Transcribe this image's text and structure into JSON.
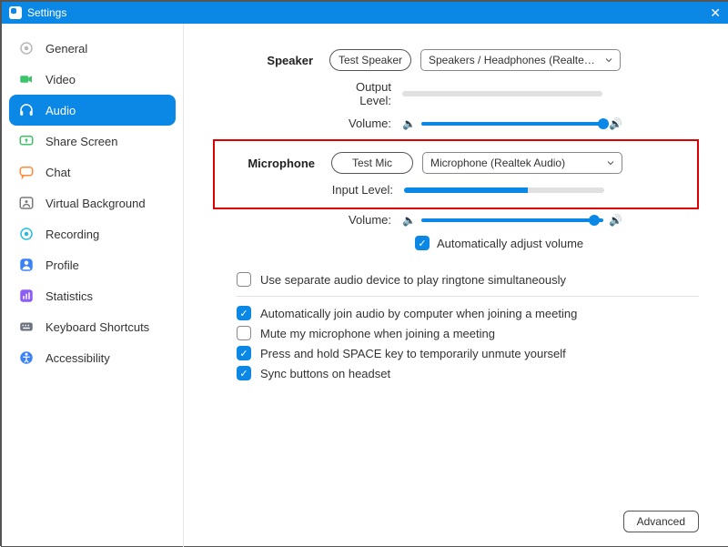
{
  "titlebar": {
    "title": "Settings"
  },
  "sidebar": {
    "items": [
      {
        "label": "General"
      },
      {
        "label": "Video"
      },
      {
        "label": "Audio"
      },
      {
        "label": "Share Screen"
      },
      {
        "label": "Chat"
      },
      {
        "label": "Virtual Background"
      },
      {
        "label": "Recording"
      },
      {
        "label": "Profile"
      },
      {
        "label": "Statistics"
      },
      {
        "label": "Keyboard Shortcuts"
      },
      {
        "label": "Accessibility"
      }
    ]
  },
  "speaker": {
    "heading": "Speaker",
    "test_label": "Test Speaker",
    "device": "Speakers / Headphones (Realtek …",
    "output_label": "Output Level:",
    "output_fill_pct": 0,
    "volume_label": "Volume:",
    "volume_pct": 100
  },
  "microphone": {
    "heading": "Microphone",
    "test_label": "Test Mic",
    "device": "Microphone (Realtek Audio)",
    "input_label": "Input Level:",
    "input_fill_pct": 62,
    "volume_label": "Volume:",
    "volume_pct": 95,
    "auto_adjust_label": "Automatically adjust volume",
    "auto_adjust_checked": true
  },
  "options": {
    "ringtone": {
      "label": "Use separate audio device to play ringtone simultaneously",
      "checked": false
    },
    "auto_join": {
      "label": "Automatically join audio by computer when joining a meeting",
      "checked": true
    },
    "mute_on_join": {
      "label": "Mute my microphone when joining a meeting",
      "checked": false
    },
    "space_unmute": {
      "label": "Press and hold SPACE key to temporarily unmute yourself",
      "checked": true
    },
    "sync_headset": {
      "label": "Sync buttons on headset",
      "checked": true
    }
  },
  "advanced_label": "Advanced"
}
